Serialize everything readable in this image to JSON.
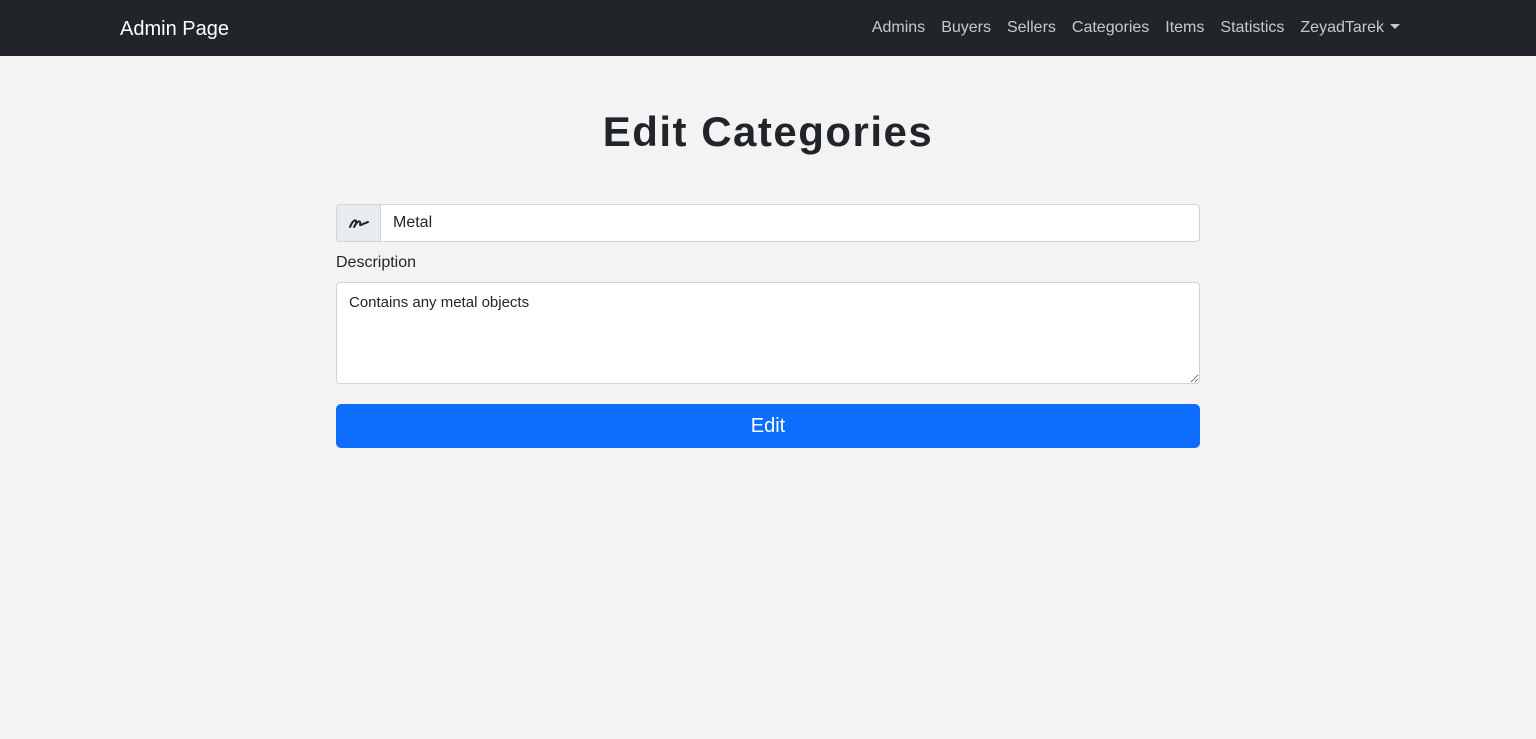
{
  "navbar": {
    "brand": "Admin Page",
    "links": [
      "Admins",
      "Buyers",
      "Sellers",
      "Categories",
      "Items",
      "Statistics"
    ],
    "user": "ZeyadTarek",
    "background": "#212529"
  },
  "page": {
    "title": "Edit Categories",
    "background": "#f3f3f3"
  },
  "form": {
    "name_icon": "signature-icon",
    "name_value": "Metal",
    "description_label": "Description",
    "description_value": "Contains any metal objects",
    "submit_label": "Edit",
    "submit_color": "#0d6efd"
  }
}
